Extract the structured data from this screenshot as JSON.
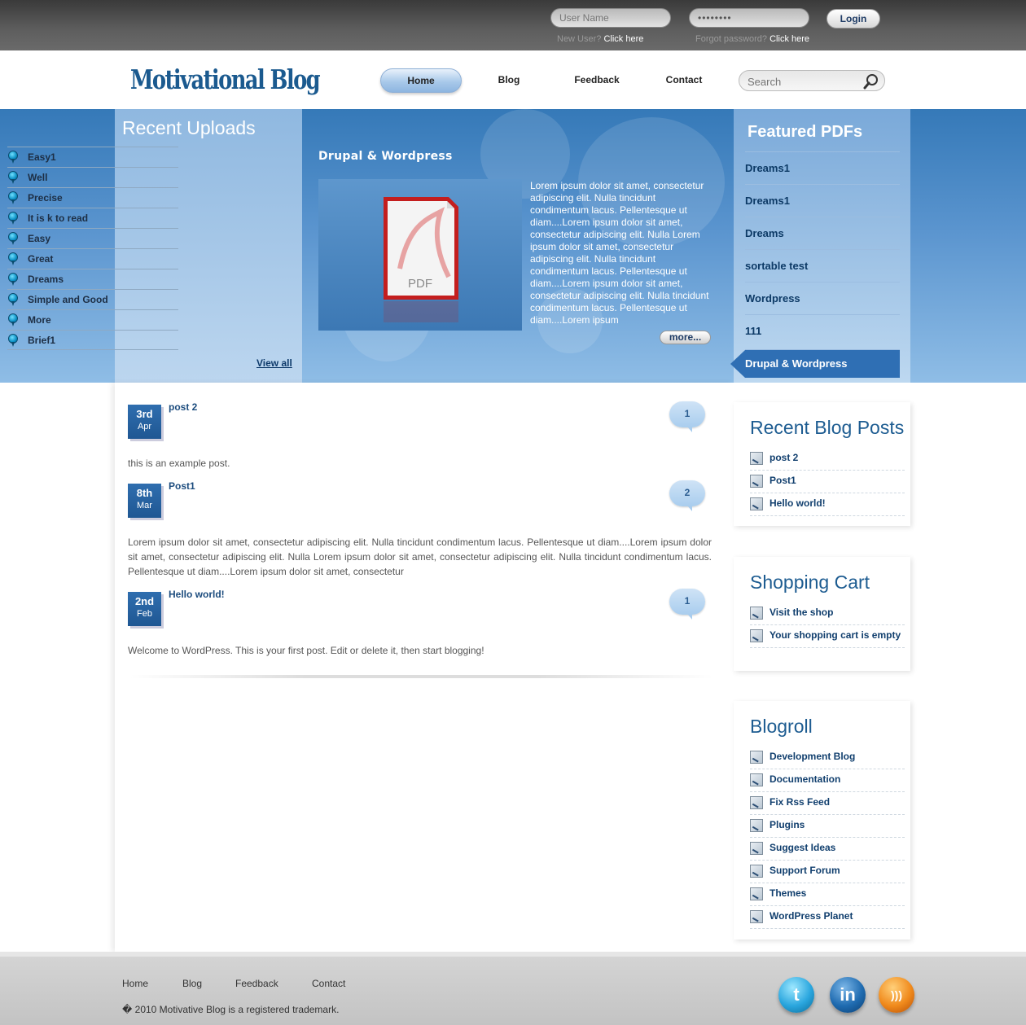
{
  "topbar": {
    "username_placeholder": "User Name",
    "password_value": "••••••••",
    "login_label": "Login",
    "new_user_text": "New User?",
    "new_user_link": "Click here",
    "forgot_text": "Forgot password?",
    "forgot_link": "Click here"
  },
  "header": {
    "logo": "Motivational Blog",
    "nav": [
      "Home",
      "Blog",
      "Feedback",
      "Contact"
    ],
    "search_placeholder": "Search"
  },
  "recent_uploads": {
    "title": "Recent Uploads",
    "items": [
      "Easy1",
      "Well",
      "Precise",
      "It is k to read",
      "Easy",
      "Great",
      "Dreams",
      "Simple and Good",
      "More",
      "Brief1"
    ],
    "view_all": "View all"
  },
  "featured": {
    "title": "Drupal & Wordpress",
    "image_label": "PDF",
    "text": "Lorem ipsum dolor sit amet, consectetur adipiscing elit. Nulla tincidunt condimentum lacus. Pellentesque ut diam....Lorem ipsum dolor sit amet, consectetur adipiscing elit. Nulla Lorem ipsum dolor sit amet, consectetur adipiscing elit. Nulla tincidunt condimentum lacus. Pellentesque ut diam....Lorem ipsum dolor sit amet, consectetur adipiscing elit. Nulla tincidunt condimentum lacus. Pellentesque ut diam....Lorem ipsum",
    "more_label": "more..."
  },
  "featured_pdfs": {
    "title": "Featured PDFs",
    "items": [
      "Dreams1",
      "Dreams1",
      "Dreams",
      "sortable test",
      "Wordpress",
      "111",
      "Drupal & Wordpress"
    ]
  },
  "posts": [
    {
      "day": "3rd",
      "month": "Apr",
      "title": "post 2",
      "comments": "1",
      "body": "this is an example post."
    },
    {
      "day": "8th",
      "month": "Mar",
      "title": "Post1",
      "comments": "2",
      "body": "Lorem ipsum dolor sit amet, consectetur adipiscing elit. Nulla tincidunt condimentum lacus. Pellentesque ut diam....Lorem ipsum dolor sit amet, consectetur adipiscing elit. Nulla Lorem ipsum dolor sit amet, consectetur adipiscing elit. Nulla tincidunt condimentum lacus. Pellentesque ut diam....Lorem ipsum dolor sit amet, consectetur"
    },
    {
      "day": "2nd",
      "month": "Feb",
      "title": "Hello world!",
      "comments": "1",
      "body": "Welcome to WordPress. This is your first post. Edit or delete it, then start blogging!"
    }
  ],
  "recent_posts": {
    "title": "Recent Blog Posts",
    "items": [
      "post 2",
      "Post1",
      "Hello world!"
    ]
  },
  "shopping_cart": {
    "title": "Shopping Cart",
    "items": [
      "Visit the shop",
      "Your shopping cart is empty"
    ]
  },
  "blogroll": {
    "title": "Blogroll",
    "items": [
      "Development Blog",
      "Documentation",
      "Fix Rss Feed",
      "Plugins",
      "Suggest Ideas",
      "Support Forum",
      "Themes",
      "WordPress Planet"
    ]
  },
  "footer": {
    "links": [
      "Home",
      "Blog",
      "Feedback",
      "Contact"
    ],
    "copyright": "� 2010 Motivative Blog is a registered trademark.",
    "social": [
      {
        "name": "twitter-icon",
        "glyph": "t"
      },
      {
        "name": "linkedin-icon",
        "glyph": "in"
      },
      {
        "name": "rss-icon",
        "glyph": ")))"
      }
    ]
  },
  "colors": {
    "brand_blue": "#1b5a8f",
    "banner_blue": "#3579b8",
    "accent_active": "#2f6fb4"
  }
}
